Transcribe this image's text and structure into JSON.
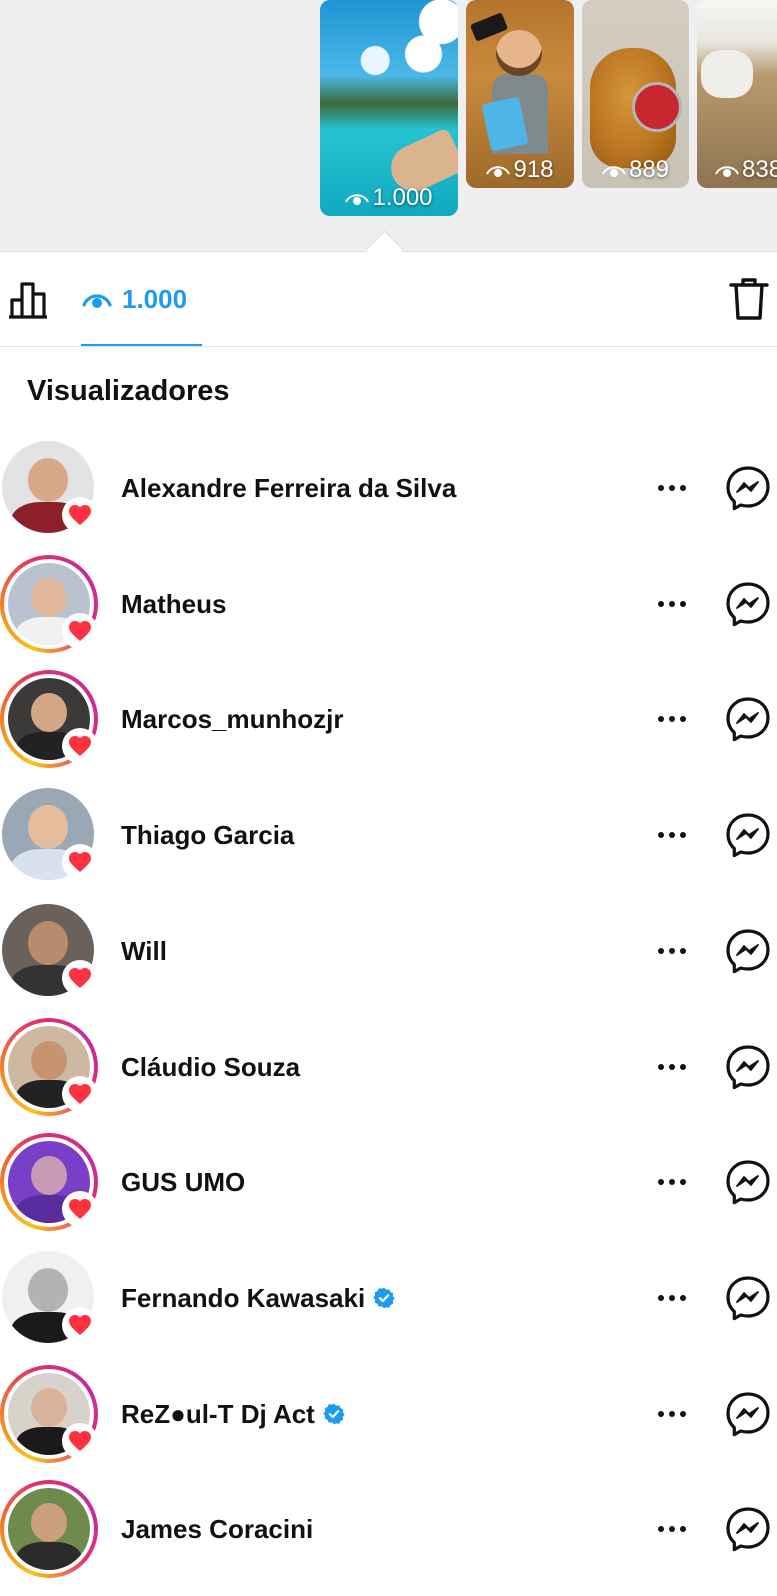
{
  "stories": [
    {
      "views": "1.000",
      "selected": true
    },
    {
      "views": "918"
    },
    {
      "views": "889"
    },
    {
      "views": "838"
    }
  ],
  "tabbar": {
    "views_count": "1.000",
    "accent_color": "#1d9bf0"
  },
  "viewers_section": {
    "title": "Visualizadores"
  },
  "viewers": [
    {
      "name": "Alexandre Ferreira da Silva",
      "verified": false,
      "ring": false,
      "liked": true
    },
    {
      "name": "Matheus",
      "verified": false,
      "ring": true,
      "liked": true
    },
    {
      "name": "Marcos_munhozjr",
      "verified": false,
      "ring": true,
      "liked": true
    },
    {
      "name": "Thiago Garcia",
      "verified": false,
      "ring": false,
      "liked": true
    },
    {
      "name": "Will",
      "verified": false,
      "ring": false,
      "liked": true
    },
    {
      "name": "Cláudio Souza",
      "verified": false,
      "ring": true,
      "liked": true
    },
    {
      "name": "GUS UMO",
      "verified": false,
      "ring": true,
      "liked": true
    },
    {
      "name": "Fernando Kawasaki",
      "verified": true,
      "ring": false,
      "liked": true
    },
    {
      "name": "ReZ●ul-T  Dj Act",
      "verified": true,
      "ring": true,
      "liked": true
    },
    {
      "name": "James Coracini",
      "verified": false,
      "ring": true,
      "liked": false
    }
  ],
  "icons": {
    "insights": "bar-chart-icon",
    "views": "eye-icon",
    "delete": "trash-icon",
    "more": "more-horizontal-icon",
    "message": "messenger-icon",
    "like": "heart-icon",
    "verified": "verified-badge-icon"
  },
  "colors": {
    "heart": "#ff3040",
    "verified": "#1d9bf0"
  }
}
